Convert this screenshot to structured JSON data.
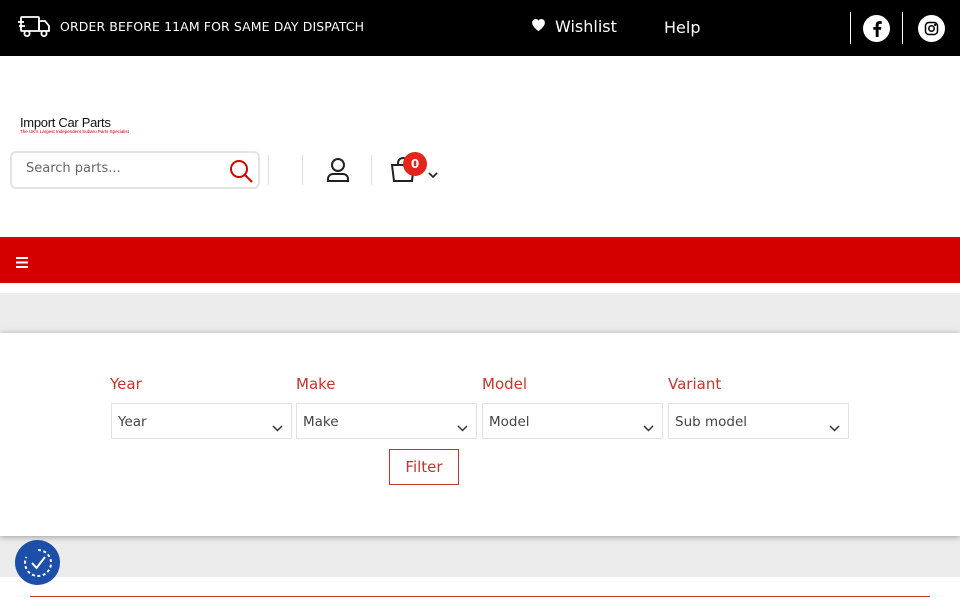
{
  "topbar": {
    "dispatch_text": "ORDER BEFORE 11AM FOR SAME DAY DISPATCH",
    "wishlist_label": "Wishlist",
    "help_label": "Help",
    "icons": [
      "truck-icon",
      "heart-icon",
      "facebook-icon",
      "instagram-icon"
    ]
  },
  "header": {
    "logo_title": "Import Car Parts",
    "logo_subtitle": "The UK's Largest Independent Subaru Parts Specialist",
    "search": {
      "placeholder": "Search parts..."
    },
    "cart_count": "0"
  },
  "filter": {
    "fields": [
      {
        "label": "Year",
        "value": "Year"
      },
      {
        "label": "Make",
        "value": "Make"
      },
      {
        "label": "Model",
        "value": "Model"
      },
      {
        "label": "Variant",
        "value": "Sub model"
      }
    ],
    "button_label": "Filter"
  },
  "colors": {
    "topbar_bg": "#000000",
    "nav_red": "#d40000",
    "accent_red": "#c8342b",
    "badge_red": "#e5241b",
    "a11y_blue": "#1c4fa8"
  }
}
